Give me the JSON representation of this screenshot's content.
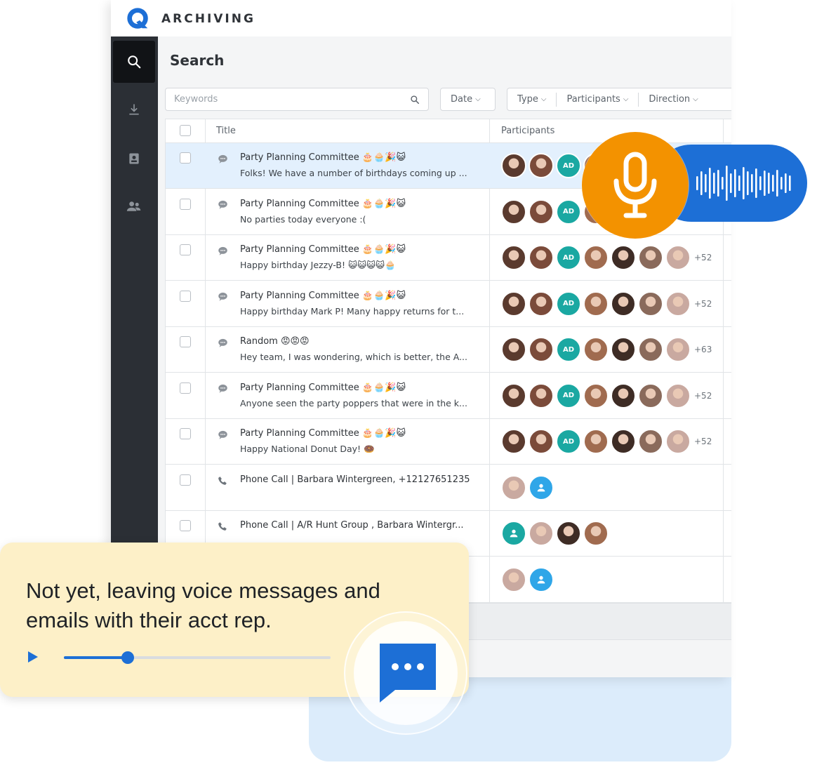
{
  "brand": {
    "name": "ARCHIVING"
  },
  "header": {
    "title": "Search"
  },
  "search": {
    "placeholder": "Keywords"
  },
  "filters": {
    "date": "Date",
    "type": "Type",
    "participants": "Participants",
    "direction": "Direction"
  },
  "table": {
    "columns": {
      "title": "Title",
      "participants": "Participants"
    },
    "rows": [
      {
        "kind": "chat",
        "title": "Party Planning Committee 🎂🧁🎉😺",
        "subtitle": "Folks! We have a number of birthdays coming up ...",
        "selected": true,
        "more": ""
      },
      {
        "kind": "chat",
        "title": "Party Planning Committee 🎂🧁🎉😺",
        "subtitle": "No parties today everyone :(",
        "selected": false,
        "more": ""
      },
      {
        "kind": "chat",
        "title": "Party Planning Committee 🎂🧁🎉😺",
        "subtitle": "Happy birthday Jezzy-B! 😺😺😺😺🧁",
        "selected": false,
        "more": "+52"
      },
      {
        "kind": "chat",
        "title": "Party Planning Committee 🎂🧁🎉😺",
        "subtitle": "Happy birthday Mark P! Many happy returns for t...",
        "selected": false,
        "more": "+52"
      },
      {
        "kind": "chat",
        "title": "Random 😡😡😡",
        "subtitle": "Hey team, I was wondering, which is better, the A...",
        "selected": false,
        "more": "+63"
      },
      {
        "kind": "chat",
        "title": "Party Planning Committee 🎂🧁🎉😺",
        "subtitle": "Anyone seen the party poppers that were in the k...",
        "selected": false,
        "more": "+52"
      },
      {
        "kind": "chat",
        "title": "Party Planning Committee 🎂🧁🎉😺",
        "subtitle": "Happy National Donut Day! 🍩",
        "selected": false,
        "more": "+52"
      },
      {
        "kind": "call",
        "title": "Phone Call | Barbara Wintergreen, +12127651235",
        "subtitle": "",
        "selected": false,
        "more": ""
      },
      {
        "kind": "call",
        "title": "Phone Call | A/R Hunt Group , Barbara Wintergr...",
        "subtitle": "",
        "selected": false,
        "more": ""
      },
      {
        "kind": "call",
        "title": "",
        "subtitle": "",
        "selected": false,
        "more": ""
      }
    ]
  },
  "initials_avatar": "AD",
  "message_card": {
    "text": "Not yet, leaving voice messages and emails with their acct rep.",
    "progress": 0.24
  },
  "colors": {
    "accent_blue": "#1d6fd6",
    "mic_orange": "#f39200",
    "card_yellow": "#fdf0c8",
    "teal": "#1aa8a2"
  },
  "icons": {
    "rail": [
      "search-icon",
      "download-icon",
      "contacts-icon",
      "users-icon"
    ],
    "mic": "microphone-icon",
    "chat": "chat-bubble-icon"
  }
}
